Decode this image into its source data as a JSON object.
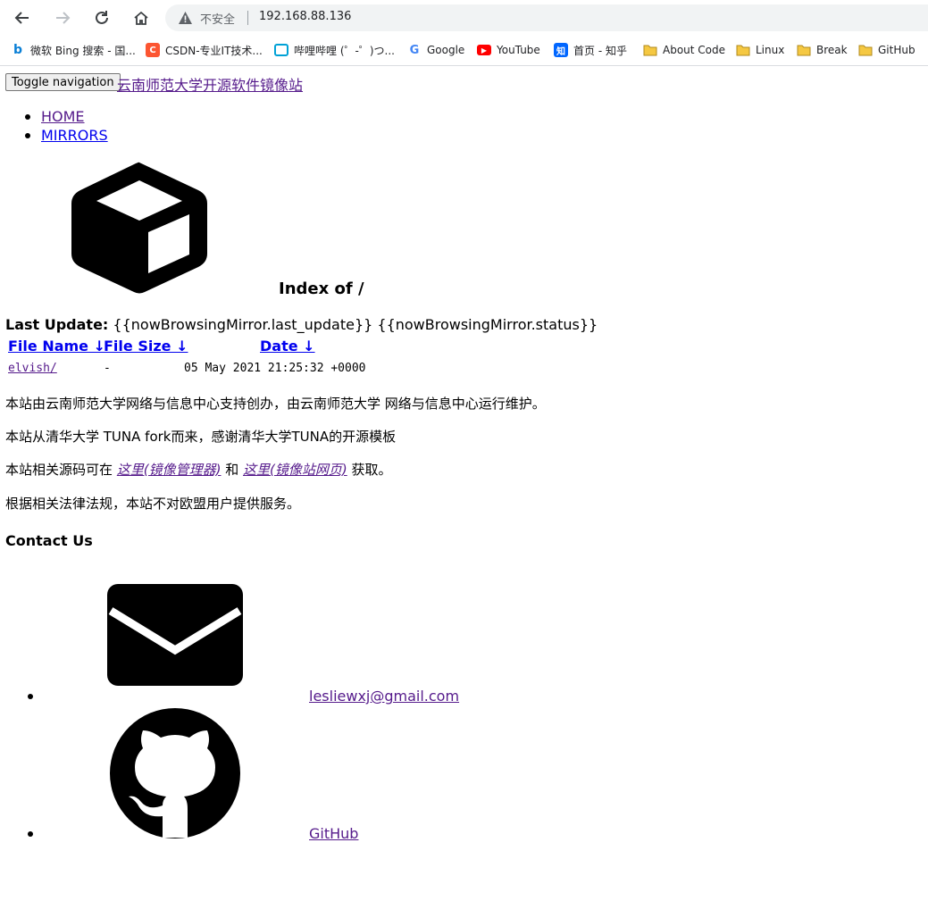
{
  "browser": {
    "insecure_label": "不安全",
    "url": "192.168.88.136",
    "bookmarks": [
      {
        "label": "微软 Bing 搜索 - 国...",
        "icon": "bing-icon"
      },
      {
        "label": "CSDN-专业IT技术...",
        "icon": "csdn-icon"
      },
      {
        "label": "哔哩哔哩 (゜-゜)つ...",
        "icon": "bilibili-icon"
      },
      {
        "label": "Google",
        "icon": "google-icon"
      },
      {
        "label": "YouTube",
        "icon": "youtube-icon"
      },
      {
        "label": "首页 - 知乎",
        "icon": "zhihu-icon"
      },
      {
        "label": "About Code",
        "icon": "folder-icon"
      },
      {
        "label": "Linux",
        "icon": "folder-icon"
      },
      {
        "label": "Break",
        "icon": "folder-icon"
      },
      {
        "label": "GitHub",
        "icon": "folder-icon"
      }
    ]
  },
  "page": {
    "toggle_label": "Toggle navigation",
    "brand": "云南师范大学开源软件镜像站",
    "nav": [
      "HOME",
      "MIRRORS"
    ],
    "index_title": "Index of /",
    "last_update_label": "Last Update:",
    "last_update_value": "{{nowBrowsingMirror.last_update}} {{nowBrowsingMirror.status}}",
    "table": {
      "headers": [
        "File Name ↓",
        "File Size ↓",
        "Date ↓"
      ],
      "rows": [
        {
          "name": "elvish/",
          "size": "-",
          "date": "05 May 2021 21:25:32 +0000"
        }
      ]
    },
    "para1": "本站由云南师范大学网络与信息中心支持创办，由云南师范大学 网络与信息中心运行维护。",
    "para2": "本站从清华大学 TUNA fork而来，感谢清华大学TUNA的开源模板",
    "para3_prefix": "本站相关源码可在 ",
    "para3_link1": "这里(镜像管理器)",
    "para3_mid": " 和 ",
    "para3_link2": "这里(镜像站网页)",
    "para3_suffix": " 获取。",
    "para4": "根据相关法律法规，本站不对欧盟用户提供服务。",
    "contact_heading": "Contact Us",
    "contacts": [
      {
        "label": "lesliewxj@gmail.com",
        "icon": "mail-icon"
      },
      {
        "label": "GitHub",
        "icon": "github-icon"
      }
    ]
  }
}
